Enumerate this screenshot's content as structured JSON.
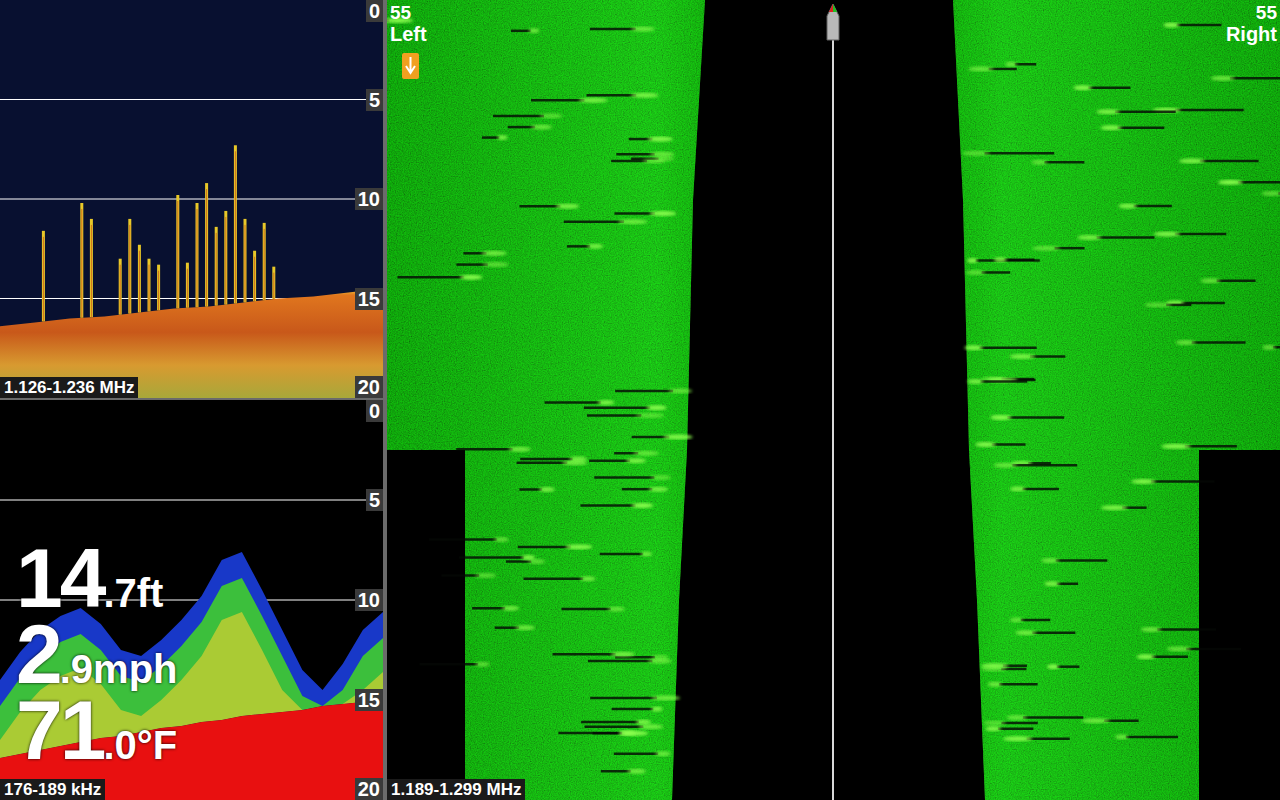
{
  "down_imaging": {
    "frequency": "1.126-1.236 MHz",
    "depth_scale": [
      "0",
      "5",
      "10",
      "15",
      "20"
    ],
    "bottom_depth_ft": [
      16.4,
      16.2,
      16.0,
      15.9,
      15.7,
      15.5,
      15.4,
      15.2,
      15.0,
      14.9,
      14.7,
      14.5
    ],
    "weed_tops_ft": [
      0,
      0,
      0,
      0,
      11.6,
      0,
      0,
      0,
      10.2,
      11.0,
      0,
      0,
      13.0,
      11.0,
      12.3,
      13.0,
      13.3,
      0,
      9.8,
      13.2,
      10.2,
      9.2,
      11.4,
      10.6,
      7.3,
      11.0,
      12.6,
      11.2,
      13.4,
      0,
      0,
      0,
      0,
      0,
      0,
      0,
      0,
      0,
      0,
      0
    ]
  },
  "sonar_2d": {
    "frequency": "176-189 kHz",
    "depth_scale": [
      "0",
      "5",
      "10",
      "15",
      "20"
    ],
    "bottom_depth_ft": [
      17.9,
      17.7,
      17.5,
      17.3,
      17.1,
      16.9,
      16.8,
      16.6,
      16.4,
      16.3,
      16.1,
      16.0,
      15.8,
      15.7,
      15.6,
      15.5,
      15.3,
      15.2,
      15.1,
      15.0
    ],
    "clutter_top_ft": [
      14.0,
      12.6,
      11.5,
      10.8,
      10.4,
      11.2,
      12.5,
      12.8,
      12.0,
      11.0,
      9.8,
      8.0,
      7.6,
      9.5,
      11.5,
      13.5,
      14.5,
      13.2,
      11.5,
      10.6
    ]
  },
  "readouts": [
    {
      "value": "14",
      "fraction": ".7",
      "unit": "ft"
    },
    {
      "value": "2",
      "fraction": ".9",
      "unit": "mph"
    },
    {
      "value": "71",
      "fraction": ".0",
      "unit": "°F"
    }
  ],
  "side_imaging": {
    "frequency": "1.189-1.299 MHz",
    "left": {
      "range": "55",
      "label": "Left"
    },
    "right": {
      "range": "55",
      "label": "Right"
    }
  }
}
